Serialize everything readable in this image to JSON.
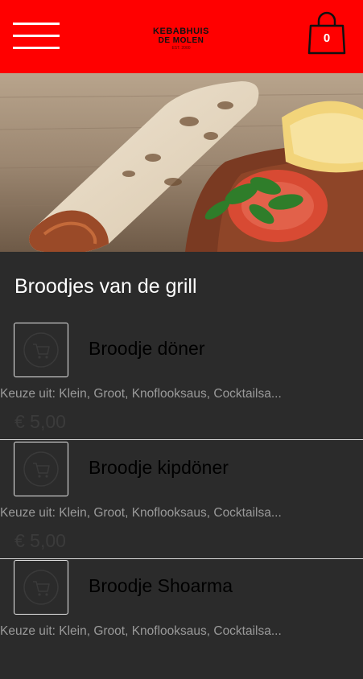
{
  "header": {
    "logo_line1": "KEBABHUIS",
    "logo_line2": "DE MOLEN",
    "logo_line3": "EST. 2000",
    "cart_count": "0",
    "menu_icon": "hamburger-icon",
    "cart_icon": "shopping-bag-icon"
  },
  "hero": {
    "image_desc": "doner wrap with tomato, parsley and lemon"
  },
  "section": {
    "title": "Broodjes van de grill"
  },
  "items": [
    {
      "name": "Broodje döner",
      "desc": "Keuze uit: Klein, Groot, Knoflooksaus, Cocktailsa...",
      "price": "€ 5,00"
    },
    {
      "name": "Broodje kipdöner",
      "desc": "Keuze uit: Klein, Groot, Knoflooksaus, Cocktailsa...",
      "price": "€ 5,00"
    },
    {
      "name": "Broodje Shoarma",
      "desc": "Keuze uit: Klein, Groot, Knoflooksaus, Cocktailsa...",
      "price": ""
    }
  ],
  "colors": {
    "brand_red": "#ff0000",
    "background": "#2b2b2b"
  }
}
